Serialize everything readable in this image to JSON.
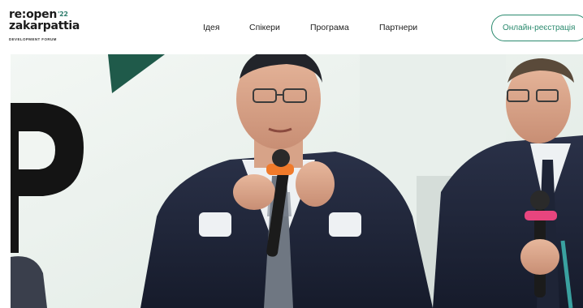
{
  "header": {
    "logo": {
      "line1": "re:open",
      "year": "'22",
      "line2": "zakarpattia",
      "subtitle": "DEVELOPMENT FORUM"
    },
    "nav": [
      {
        "label": "Ідея"
      },
      {
        "label": "Спікери"
      },
      {
        "label": "Програма"
      },
      {
        "label": "Партнери"
      }
    ],
    "register_label": "Онлайн-реєстрація"
  },
  "hero": {
    "image": "panel-speakers-photo",
    "colors": {
      "accent": "#2a8a6e",
      "mic_orange": "#f07a2a",
      "mic_pink": "#e8457e"
    }
  }
}
